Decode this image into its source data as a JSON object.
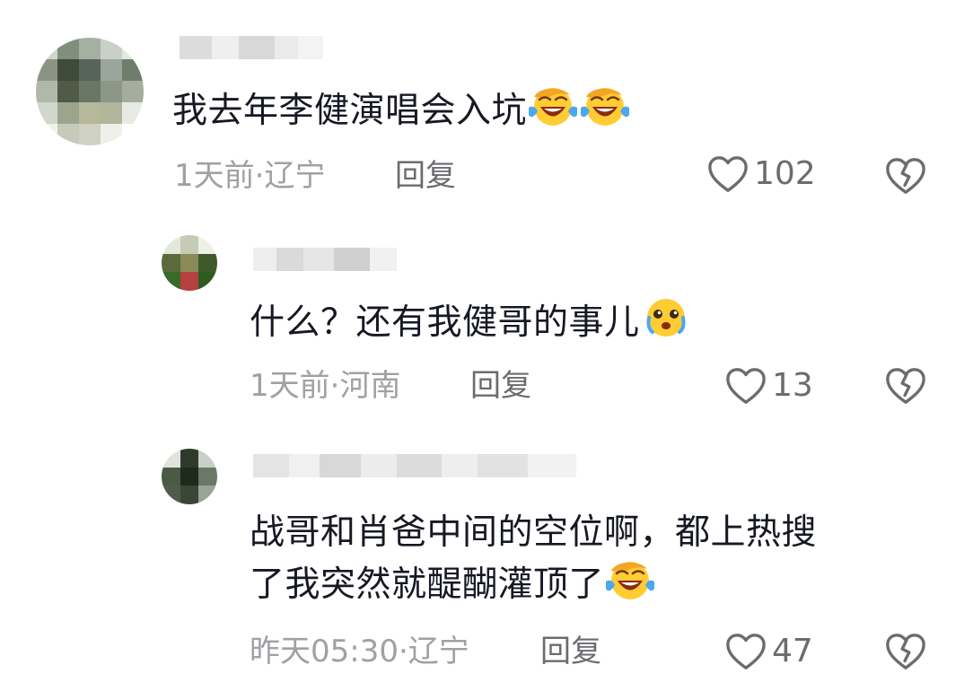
{
  "comments": [
    {
      "text": "我去年李健演唱会入坑",
      "emojis": [
        "crying-laughing-emoji",
        "crying-laughing-emoji"
      ],
      "time_location": "1天前·辽宁",
      "reply_label": "回复",
      "likes": "102"
    },
    {
      "text": "什么？还有我健哥的事儿",
      "emojis": [
        "teary-eyed-emoji"
      ],
      "time_location": "1天前·河南",
      "reply_label": "回复",
      "likes": "13"
    },
    {
      "text_line1": "战哥和肖爸中间的空位啊，都上热搜",
      "text_line2": "了我突然就醍醐灌顶了",
      "emojis": [
        "crying-laughing-emoji"
      ],
      "time_location": "昨天05:30·辽宁",
      "reply_label": "回复",
      "likes": "47"
    }
  ],
  "icons": {
    "like": "heart-outline-icon",
    "dislike": "broken-heart-icon"
  },
  "colors": {
    "text": "#161823",
    "meta": "#a0a0a5",
    "action": "#6b6b70",
    "emoji_yellow": "#ffcc33",
    "emoji_tear": "#4aa8f0"
  }
}
